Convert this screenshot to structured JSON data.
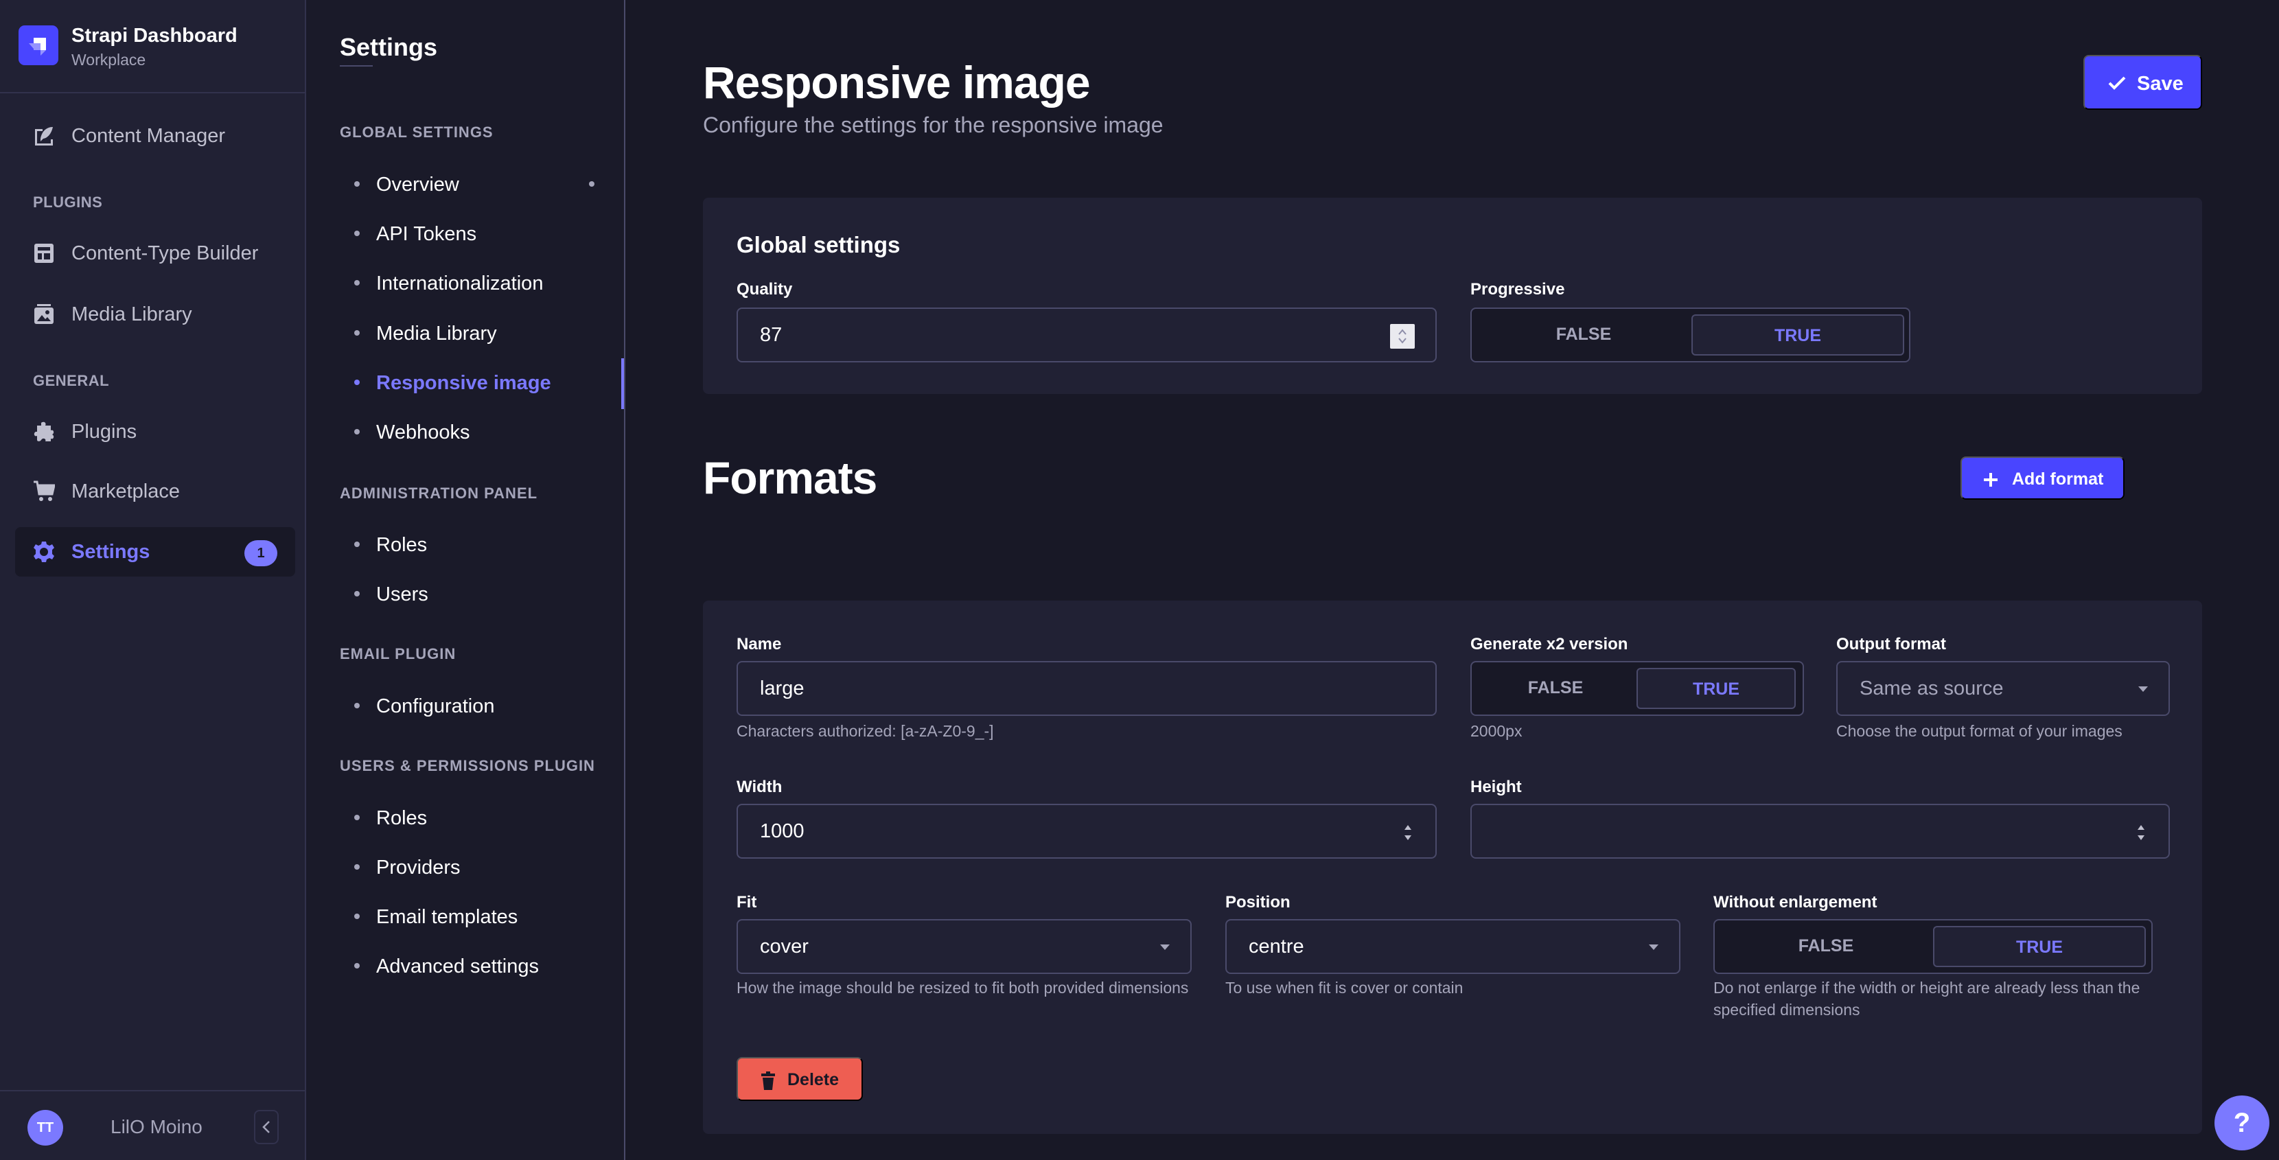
{
  "brand": {
    "title": "Strapi Dashboard",
    "subtitle": "Workplace",
    "accent": "#4945ff"
  },
  "nav": {
    "content_manager": "Content Manager",
    "sections": {
      "plugins": "PLUGINS",
      "general": "GENERAL"
    },
    "items": [
      {
        "label": "Content-Type Builder",
        "icon": "layout-icon"
      },
      {
        "label": "Media Library",
        "icon": "image-icon"
      },
      {
        "label": "Plugins",
        "icon": "puzzle-icon"
      },
      {
        "label": "Marketplace",
        "icon": "cart-icon"
      },
      {
        "label": "Settings",
        "icon": "gear-icon",
        "badge": "1",
        "active": true
      }
    ]
  },
  "user": {
    "initials": "TT",
    "name": "LilO Moino"
  },
  "settings_nav": {
    "title": "Settings",
    "sections": [
      {
        "title": "GLOBAL SETTINGS",
        "items": [
          "Overview",
          "API Tokens",
          "Internationalization",
          "Media Library",
          "Responsive image",
          "Webhooks"
        ]
      },
      {
        "title": "ADMINISTRATION PANEL",
        "items": [
          "Roles",
          "Users"
        ]
      },
      {
        "title": "EMAIL PLUGIN",
        "items": [
          "Configuration"
        ]
      },
      {
        "title": "USERS & PERMISSIONS PLUGIN",
        "items": [
          "Roles",
          "Providers",
          "Email templates",
          "Advanced settings"
        ]
      }
    ],
    "active_item": "Responsive image"
  },
  "page": {
    "title": "Responsive image",
    "subtitle": "Configure the settings for the responsive image",
    "save_label": "Save"
  },
  "global_settings": {
    "title": "Global settings",
    "quality_label": "Quality",
    "quality_value": "87",
    "progressive_label": "Progressive",
    "progressive_false": "FALSE",
    "progressive_true": "TRUE",
    "progressive_value": true
  },
  "formats": {
    "title": "Formats",
    "add_label": "Add format",
    "items": [
      {
        "name_label": "Name",
        "name_value": "large",
        "name_hint": "Characters authorized: [a-zA-Z0-9_-]",
        "x2_label": "Generate x2 version",
        "x2_false": "FALSE",
        "x2_true": "TRUE",
        "x2_value": true,
        "x2_hint": "2000px",
        "output_label": "Output format",
        "output_value": "Same as source",
        "output_hint": "Choose the output format of your images",
        "width_label": "Width",
        "width_value": "1000",
        "height_label": "Height",
        "height_value": "",
        "fit_label": "Fit",
        "fit_value": "cover",
        "fit_hint": "How the image should be resized to fit both provided dimensions",
        "position_label": "Position",
        "position_value": "centre",
        "position_hint": "To use when fit is cover or contain",
        "enlarge_label": "Without enlargement",
        "enlarge_false": "FALSE",
        "enlarge_true": "TRUE",
        "enlarge_value": true,
        "enlarge_hint": "Do not enlarge if the width or height are already less than the specified dimensions",
        "delete_label": "Delete"
      }
    ]
  },
  "help": {
    "label": "?"
  }
}
